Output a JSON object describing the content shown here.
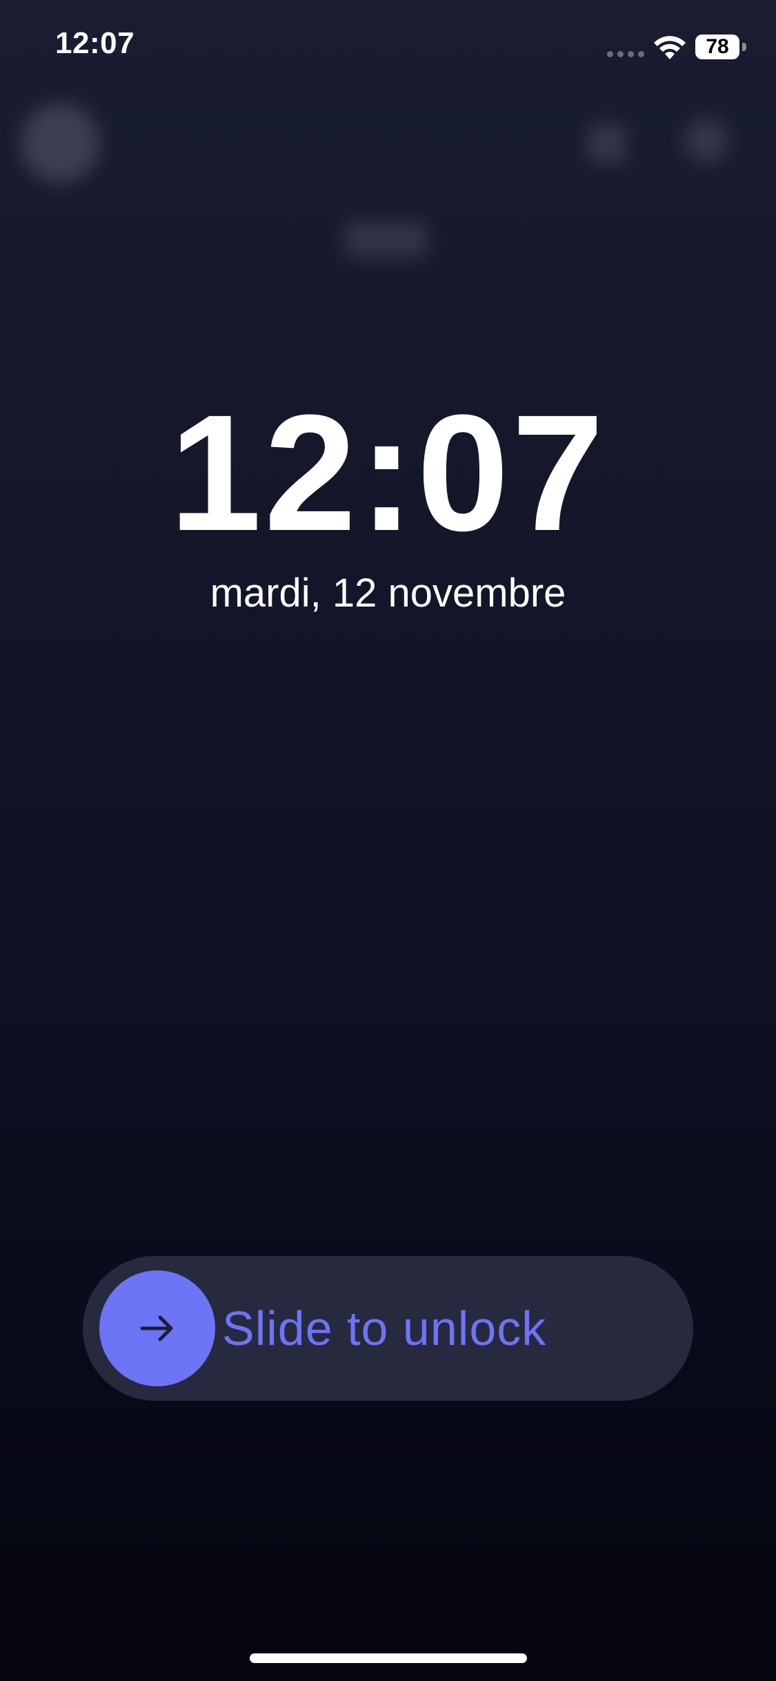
{
  "status_bar": {
    "time": "12:07",
    "battery": "78"
  },
  "lock_screen": {
    "clock": "12:07",
    "date": "mardi, 12 novembre"
  },
  "slider": {
    "label": "Slide to unlock",
    "accent_color": "#6d74f5",
    "icon": "arrow-right-icon"
  },
  "background_icons": [
    "avatar",
    "lock-icon",
    "gear-icon"
  ]
}
